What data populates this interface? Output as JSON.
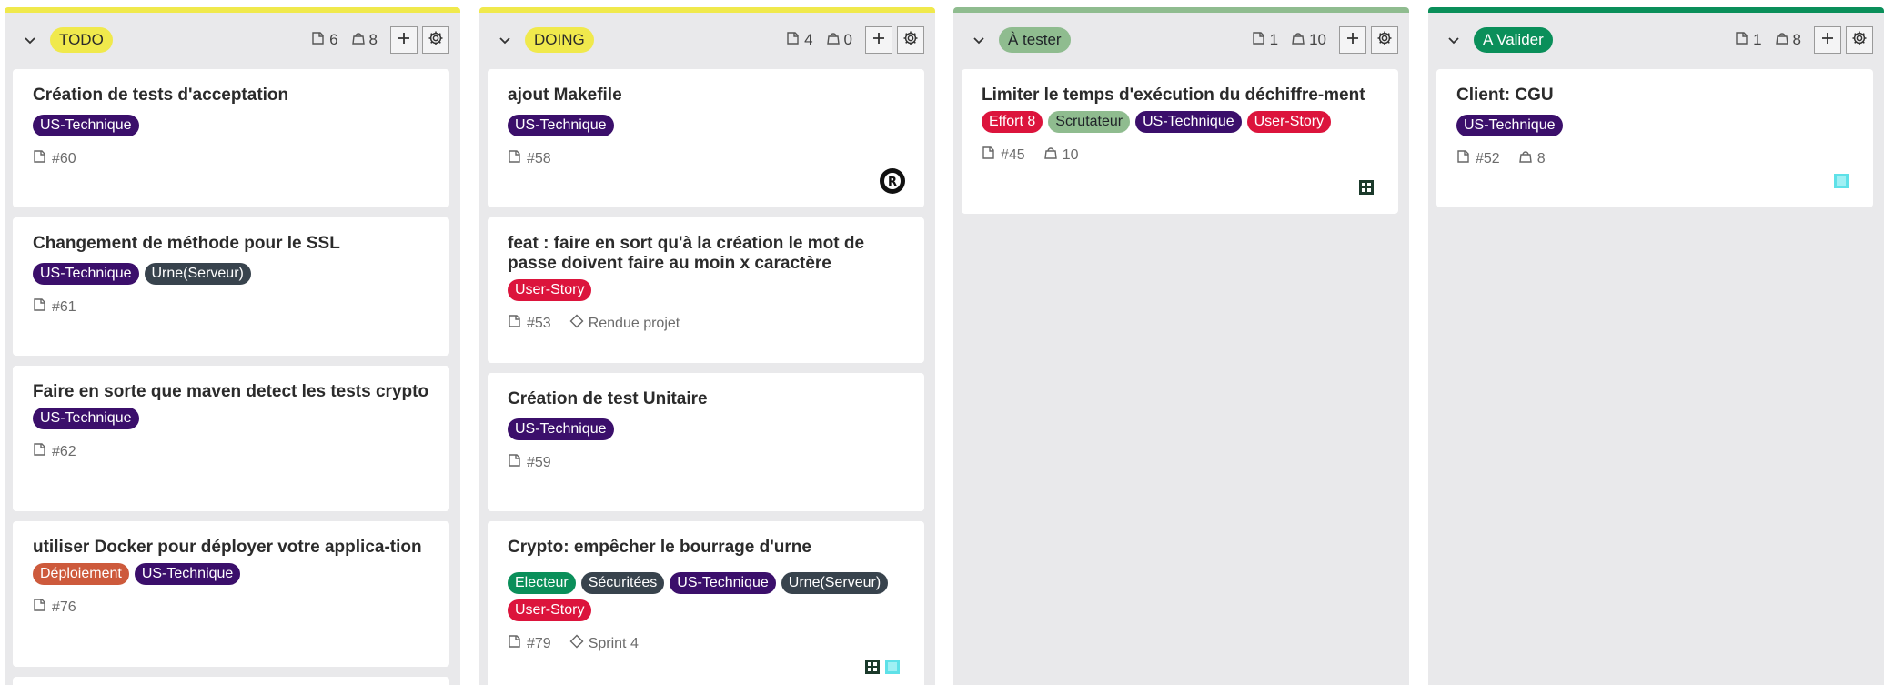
{
  "colors": {
    "US-Technique": "#3b0f6b",
    "Urne(Serveur)": "#38434d",
    "User-Story": "#dc143c",
    "Déploiement": "#cd5a3c",
    "Electeur": "#0a8f5a",
    "Sécuritées": "#38434d",
    "Effort 8": "#dc143c",
    "Scrutateur": "#8fbc8f"
  },
  "columns": [
    {
      "label": "TODO",
      "label_bg": "#f0e94c",
      "label_fg": "#2b2b2b",
      "top_color": "#f0e94c",
      "issues_count": "6",
      "weight_count": "8",
      "cards": [
        {
          "title": "Création de tests d'acceptation",
          "tags": [
            "US-Technique"
          ],
          "issue": "#60",
          "weight": "",
          "milestone": "",
          "avatars": []
        },
        {
          "title": "Changement de méthode pour le SSL",
          "tags": [
            "US-Technique",
            "Urne(Serveur)"
          ],
          "issue": "#61",
          "weight": "",
          "milestone": "",
          "avatars": []
        },
        {
          "title": "Faire en sorte que maven detect les tests crypto",
          "tags": [
            "US-Technique"
          ],
          "issue": "#62",
          "weight": "",
          "milestone": "",
          "avatars": []
        },
        {
          "title": "utiliser Docker pour déployer votre applica-tion",
          "tags": [
            "Déploiement",
            "US-Technique"
          ],
          "issue": "#76",
          "weight": "",
          "milestone": "",
          "avatars": []
        }
      ]
    },
    {
      "label": "DOING",
      "label_bg": "#f0e94c",
      "label_fg": "#2b2b2b",
      "top_color": "#f0e94c",
      "issues_count": "4",
      "weight_count": "0",
      "cards": [
        {
          "title": "ajout Makefile",
          "tags": [
            "US-Technique"
          ],
          "issue": "#58",
          "weight": "",
          "milestone": "",
          "avatars": [
            "rust"
          ]
        },
        {
          "title": "feat : faire en sort qu'à la création le mot de passe doivent faire au moin x caractère",
          "tags": [
            "User-Story"
          ],
          "issue": "#53",
          "weight": "",
          "milestone": "Rendue projet",
          "avatars": []
        },
        {
          "title": "Création de test Unitaire",
          "tags": [
            "US-Technique"
          ],
          "issue": "#59",
          "weight": "",
          "milestone": "",
          "avatars": []
        },
        {
          "title": "Crypto: empêcher le bourrage d'urne",
          "tags": [
            "Electeur",
            "Sécuritées",
            "US-Technique",
            "Urne(Serveur)",
            "User-Story"
          ],
          "issue": "#79",
          "weight": "",
          "milestone": "Sprint 4",
          "avatars": [
            "pixel-dark",
            "pixel-cyan"
          ]
        }
      ]
    },
    {
      "label": "À tester",
      "label_bg": "#8fbc8f",
      "label_fg": "#1f2328",
      "top_color": "#8fbc8f",
      "issues_count": "1",
      "weight_count": "10",
      "cards": [
        {
          "title": "Limiter le temps d'exécution du déchiffre-ment",
          "tags": [
            "Effort 8",
            "Scrutateur",
            "US-Technique",
            "User-Story"
          ],
          "issue": "#45",
          "weight": "10",
          "milestone": "",
          "avatars": [
            "pixel-dark"
          ]
        }
      ]
    },
    {
      "label": "A Valider",
      "label_bg": "#0a8f5a",
      "label_fg": "#ffffff",
      "top_color": "#0a8f5a",
      "issues_count": "1",
      "weight_count": "8",
      "cards": [
        {
          "title": "Client: CGU",
          "tags": [
            "US-Technique"
          ],
          "issue": "#52",
          "weight": "8",
          "milestone": "",
          "avatars": [
            "pixel-cyan"
          ]
        }
      ]
    }
  ]
}
